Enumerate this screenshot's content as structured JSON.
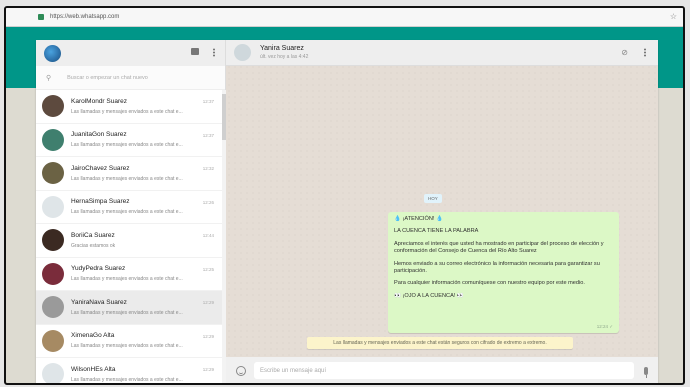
{
  "browser": {
    "url": "https://web.whatsapp.com"
  },
  "sidebar": {
    "search_placeholder": "Buscar o empezar un chat nuevo",
    "chats": [
      {
        "name": "KarolMondr Suarez",
        "preview": "Las llamadas y mensajes enviados a este chat e...",
        "time": "12:37",
        "avatar_color": "#5d4a3e"
      },
      {
        "name": "JuanitaGon Suarez",
        "preview": "Las llamadas y mensajes enviados a este chat e...",
        "time": "12:37",
        "avatar_color": "#3f7f6e"
      },
      {
        "name": "JairoChavez Suarez",
        "preview": "Las llamadas y mensajes enviados a este chat e...",
        "time": "12:32",
        "avatar_color": "#6b6244"
      },
      {
        "name": "HernaSimpa Suarez",
        "preview": "Las llamadas y mensajes enviados a este chat e...",
        "time": "12:26",
        "avatar_color": "#dfe5e8"
      },
      {
        "name": "BoriiCa Suarez",
        "preview": "Gracias estamos ok",
        "time": "12:44",
        "avatar_color": "#3b2a22"
      },
      {
        "name": "YudyPedra Suarez",
        "preview": "Las llamadas y mensajes enviados a este chat e...",
        "time": "12:25",
        "avatar_color": "#7a2c3b"
      },
      {
        "name": "YaniraNava Suarez",
        "preview": "Las llamadas y mensajes enviados a este chat e...",
        "time": "12:29",
        "avatar_color": "#9a9a9a"
      },
      {
        "name": "XimenaGo Alta",
        "preview": "Las llamadas y mensajes enviados a este chat e...",
        "time": "12:29",
        "avatar_color": "#a68a63"
      },
      {
        "name": "WilsonHEs Alta",
        "preview": "Las llamadas y mensajes enviados a este chat e...",
        "time": "12:29",
        "avatar_color": "#dfe5e8"
      }
    ]
  },
  "conversation": {
    "contact_name": "Yanira Suarez",
    "last_seen": "últ. vez hoy a las 4:42",
    "day_label": "HOY",
    "message": {
      "lines": [
        "💧 ¡ATENCIÓN! 💧",
        "LA CUENCA TIENE LA PALABRA",
        "Apreciamos el interés que usted ha mostrado en participar del proceso de elección y conformación del Consejo de Cuenca del Río  Alto Suarez",
        "Hemos enviado a su correo electrónico  la información necesaria para garantizar su participación.",
        "Para cualquier información comuníquese con nuestro equipo por este medio.",
        "👀 ¡OJO A LA CUENCA! 👀"
      ],
      "time": "12:24 ✓"
    },
    "encryption_notice": "Las llamadas y mensajes enviados a este chat están seguros con cifrado de extremo a extremo.",
    "composer_placeholder": "Escribe un mensaje aquí"
  },
  "colors": {
    "teal": "#009688",
    "bubble": "#dcf8c6",
    "notice": "#fcf4cb"
  }
}
